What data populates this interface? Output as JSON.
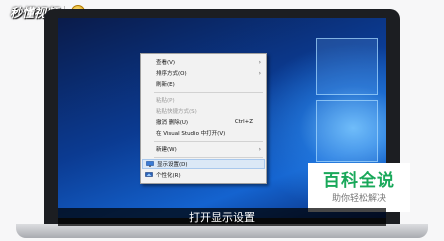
{
  "watermark": {
    "brand_text": "秒懂视频"
  },
  "context_menu": {
    "items": [
      {
        "label": "查看(V)",
        "submenu": true
      },
      {
        "label": "排序方式(O)",
        "submenu": true
      },
      {
        "label": "刷新(E)"
      },
      {
        "label": "粘贴(P)",
        "disabled": true
      },
      {
        "label": "粘贴快捷方式(S)",
        "disabled": true
      },
      {
        "label": "撤消 删除(U)",
        "shortcut": "Ctrl+Z"
      },
      {
        "label": "在 Visual Studio 中打开(V)"
      },
      {
        "label": "新建(W)",
        "submenu": true
      },
      {
        "label": "显示设置(D)",
        "highlighted": true,
        "icon": "display-settings-icon"
      },
      {
        "label": "个性化(R)",
        "icon": "personalize-icon"
      }
    ],
    "arrow_glyph": "›"
  },
  "baike": {
    "title": "百科全说",
    "subtitle": "助你轻松解决"
  },
  "subtitle": "打开显示设置",
  "colors": {
    "accent_green": "#19a85a",
    "menu_highlight": "#dbe8f6"
  }
}
